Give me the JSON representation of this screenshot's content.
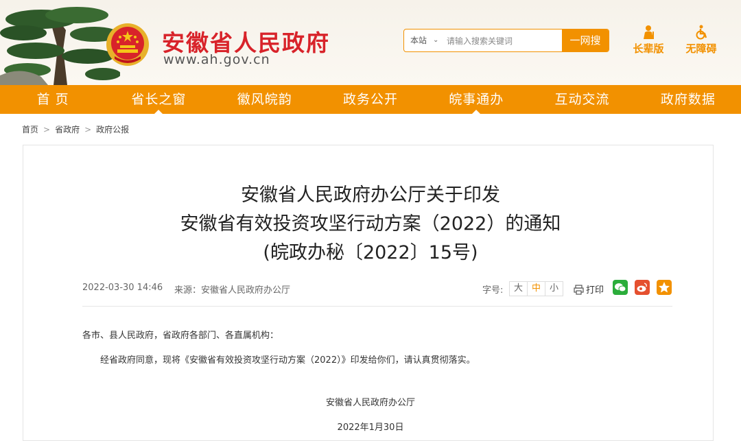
{
  "header": {
    "site_title": "安徽省人民政府",
    "site_url": "www.ah.gov.cn",
    "search": {
      "scope": "本站",
      "placeholder": "请输入搜索关键词",
      "button": "一网搜"
    },
    "tools": [
      {
        "label": "长辈版",
        "icon": "elder-icon"
      },
      {
        "label": "无障碍",
        "icon": "wheelchair-icon"
      }
    ]
  },
  "nav": {
    "items": [
      "首 页",
      "省长之窗",
      "徽风皖韵",
      "政务公开",
      "皖事通办",
      "互动交流",
      "政府数据"
    ]
  },
  "breadcrumb": [
    "首页",
    "省政府",
    "政府公报"
  ],
  "article": {
    "title_line1": "安徽省人民政府办公厅关于印发",
    "title_line2": "安徽省有效投资攻坚行动方案（2022）的通知",
    "title_line3": "(皖政办秘〔2022〕15号)",
    "date": "2022-03-30 14:46",
    "source": "来源：安徽省人民政府办公厅",
    "font_size_label": "字号:",
    "font_sizes": [
      "大",
      "中",
      "小"
    ],
    "print_label": "打印",
    "share": [
      {
        "icon": "wechat-icon",
        "color": "#2bad3b"
      },
      {
        "icon": "weibo-icon",
        "color": "#e5502f"
      },
      {
        "icon": "favorite-icon",
        "color": "#f29100"
      }
    ],
    "salutation": "各市、县人民政府，省政府各部门、各直属机构：",
    "paragraph1": "经省政府同意，现将《安徽省有效投资攻坚行动方案（2022）》印发给你们，请认真贯彻落实。",
    "signature_org": "安徽省人民政府办公厅",
    "signature_date": "2022年1月30日"
  },
  "colors": {
    "brand_orange": "#f29100",
    "title_red": "#d8232a"
  }
}
